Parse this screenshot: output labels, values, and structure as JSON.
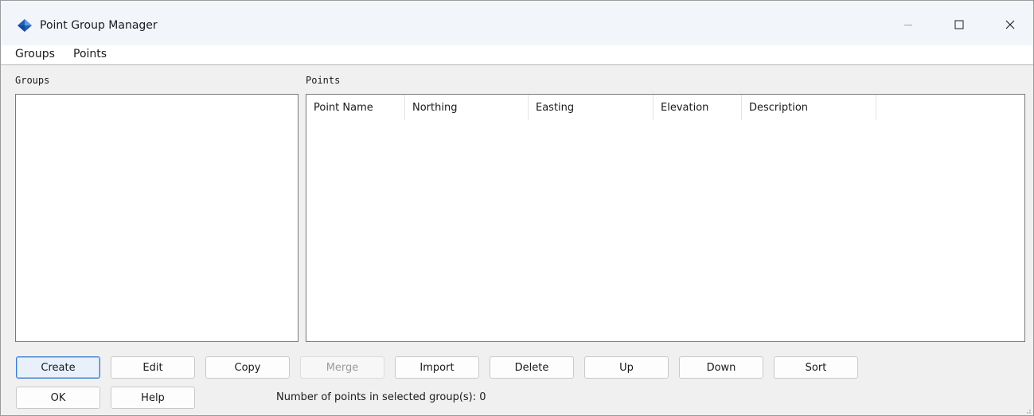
{
  "window": {
    "title": "Point Group Manager",
    "accent_color": "#1f5fb8"
  },
  "menu": [
    "Groups",
    "Points"
  ],
  "groups_panel": {
    "label": "Groups",
    "items": []
  },
  "points_panel": {
    "label": "Points",
    "columns": [
      "Point Name",
      "Northing",
      "Easting",
      "Elevation",
      "Description"
    ],
    "rows": []
  },
  "buttons": {
    "create": "Create",
    "edit": "Edit",
    "copy": "Copy",
    "merge": "Merge",
    "import": "Import",
    "delete": "Delete",
    "up": "Up",
    "down": "Down",
    "sort": "Sort",
    "ok": "OK",
    "help": "Help"
  },
  "status": {
    "label": "Number of points in selected group(s):",
    "count": "0"
  },
  "icons": {
    "app": "app-logo-icon",
    "minimize": "minimize-icon",
    "maximize": "maximize-icon",
    "close": "close-icon",
    "resize": "resize-grip-icon"
  }
}
